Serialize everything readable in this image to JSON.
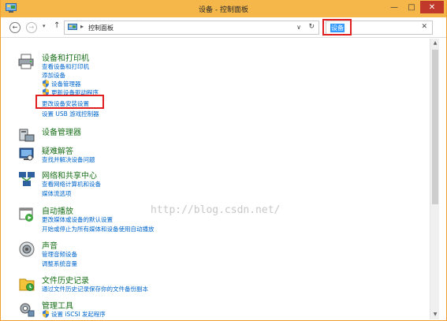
{
  "window": {
    "title": "设备 - 控制面板"
  },
  "controls": {
    "minimize": "—",
    "maximize": "□",
    "close": "✕"
  },
  "nav": {
    "back": "←",
    "forward": "→",
    "dropdown": "▾",
    "up": "↑"
  },
  "address": {
    "separator": "▸",
    "path": "控制面板",
    "dropdown": "∨",
    "refresh": "↻"
  },
  "search": {
    "value": "设备",
    "clear": "✕"
  },
  "watermark": "http://blog.csdn.net/",
  "scrollbar": {
    "up": "▲",
    "down": "▼"
  },
  "groups": [
    {
      "title": "设备和打印机",
      "icon": "printer-icon",
      "links": [
        "查看设备和打印机",
        "添加设备",
        "设备管理器",
        "更新设备驱动程序",
        "更改设备安装设置",
        "设置 USB 游戏控制器"
      ]
    },
    {
      "title": "设备管理器",
      "icon": "device-manager-icon",
      "links": []
    },
    {
      "title": "疑难解答",
      "icon": "troubleshoot-icon",
      "links": [
        "查找并解决设备问题"
      ]
    },
    {
      "title": "网络和共享中心",
      "icon": "network-icon",
      "links": [
        "查看网络计算机和设备",
        "媒体流选项"
      ]
    },
    {
      "title": "自动播放",
      "icon": "autoplay-icon",
      "links": [
        "更改媒体或设备的默认设置",
        "开始或停止为所有媒体和设备使用自动播放"
      ]
    },
    {
      "title": "声音",
      "icon": "speaker-icon",
      "links": [
        "管理音频设备",
        "调整系统音量"
      ]
    },
    {
      "title": "文件历史记录",
      "icon": "file-history-icon",
      "links": [
        "通过文件历史记录保存你的文件备份副本"
      ]
    },
    {
      "title": "管理工具",
      "icon": "admin-tools-icon",
      "links": [
        "设置 iSCSI 发起程序"
      ]
    }
  ],
  "colors": {
    "titlebar": "#f5b74a",
    "group_title": "#1a6f1a",
    "link": "#0066cc",
    "highlight": "#e02020"
  }
}
